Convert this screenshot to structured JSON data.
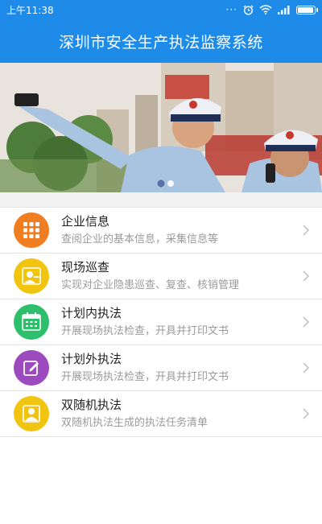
{
  "status_bar": {
    "time": "上午11:38",
    "dots": "···"
  },
  "app_bar": {
    "title": "深圳市安全生产执法监察系统"
  },
  "banner": {
    "carousel_pages": 2,
    "active_page": 1
  },
  "menu": {
    "items": [
      {
        "title": "企业信息",
        "subtitle": "查阅企业的基本信息，采集信息等",
        "icon": "grid-icon",
        "color": "#f07d1f"
      },
      {
        "title": "现场巡查",
        "subtitle": "实现对企业隐患巡查、复查、核销管理",
        "icon": "inspector-icon",
        "color": "#f0c40f"
      },
      {
        "title": "计划内执法",
        "subtitle": "开展现场执法检查，开具并打印文书",
        "icon": "calendar-icon",
        "color": "#2dbf6b"
      },
      {
        "title": "计划外执法",
        "subtitle": "开展现场执法检查，开具并打印文书",
        "icon": "edit-icon",
        "color": "#9b4bbd"
      },
      {
        "title": "双随机执法",
        "subtitle": "双随机执法生成的执法任务清单",
        "icon": "person-icon",
        "color": "#f0c40f"
      }
    ]
  }
}
